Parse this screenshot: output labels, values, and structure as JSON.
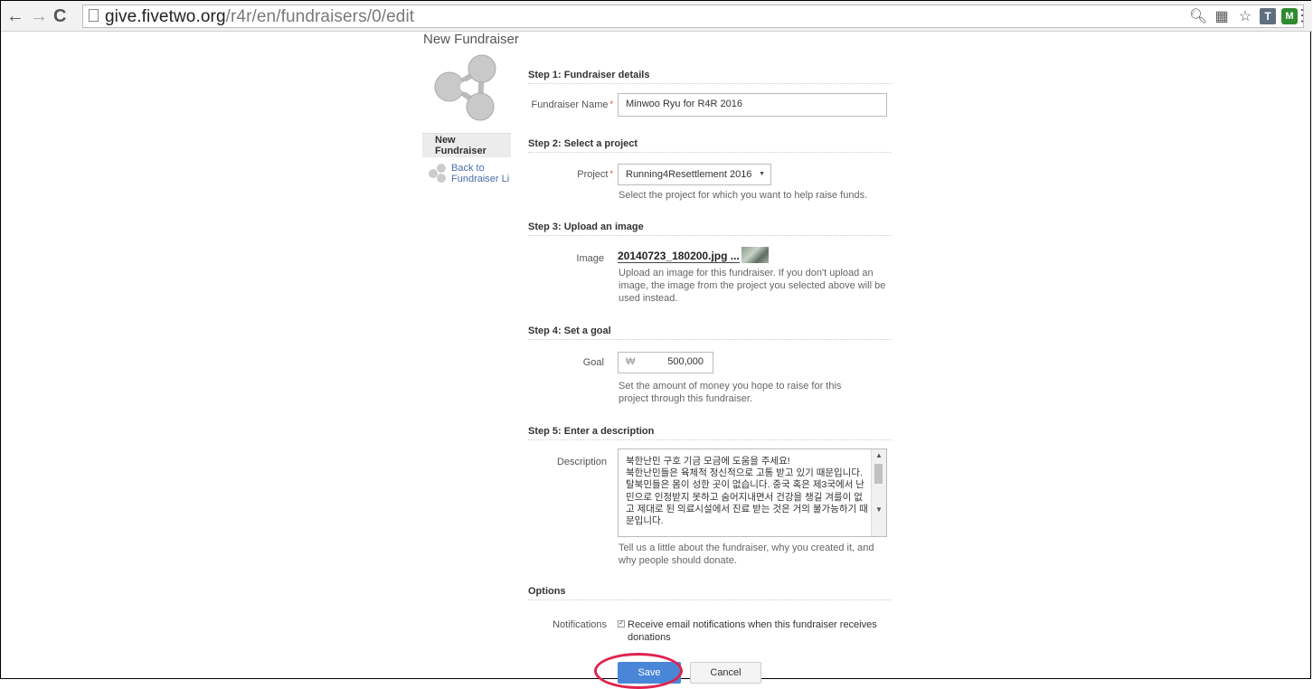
{
  "browser": {
    "url_host": "give.fivetwo.org",
    "url_path": "/r4r/en/fundraisers/0/edit",
    "ext_t_label": "T",
    "ext_m_label": "M"
  },
  "sidebar": {
    "section_title": "New Fundraiser",
    "active_item": "New Fundraiser",
    "back_link": "Back to Fundraiser Li"
  },
  "form": {
    "step1": "Step 1: Fundraiser details",
    "fundraiser_name_label": "Fundraiser Name",
    "fundraiser_name_value": "Minwoo Ryu for R4R 2016",
    "step2": "Step 2: Select a project",
    "project_label": "Project",
    "project_value": "Running4Resettlement 2016",
    "project_hint": "Select the project for which you want to help raise funds.",
    "step3": "Step 3: Upload an image",
    "image_label": "Image",
    "image_file": "20140723_180200.jpg ...",
    "image_hint": "Upload an image for this fundraiser. If you don't upload an image, the image from the project you selected above will be used instead.",
    "step4": "Step 4: Set a goal",
    "goal_label": "Goal",
    "goal_currency": "₩",
    "goal_value": "500,000",
    "goal_hint": "Set the amount of money you hope to raise for this project through this fundraiser.",
    "step5": "Step 5: Enter a description",
    "description_label": "Description",
    "description_value": "북한난민 구호 기금 모금에 도움을 주세요!\n북한난민들은 육체적 정신적으로 고통 받고 있기 때문입니다. 탈북민들은 몸이 성한 곳이 없습니다. 중국 혹은 제3국에서 난민으로 인정받지 못하고 숨어지내면서 건강을 챙길 겨를이 없고 제대로 된 의료시설에서 진료 받는 것은 거의 불가능하기 때문입니다.",
    "description_hint": "Tell us a little about the fundraiser, why you created it, and why people should donate.",
    "options_title": "Options",
    "notifications_label": "Notifications",
    "notifications_text": "Receive email notifications when this fundraiser receives donations",
    "notifications_checked": true,
    "save_label": "Save",
    "cancel_label": "Cancel"
  },
  "colors": {
    "save_button": "#4a86d8",
    "annotation_ellipse": "#e0234e",
    "required_marker": "#e33"
  }
}
